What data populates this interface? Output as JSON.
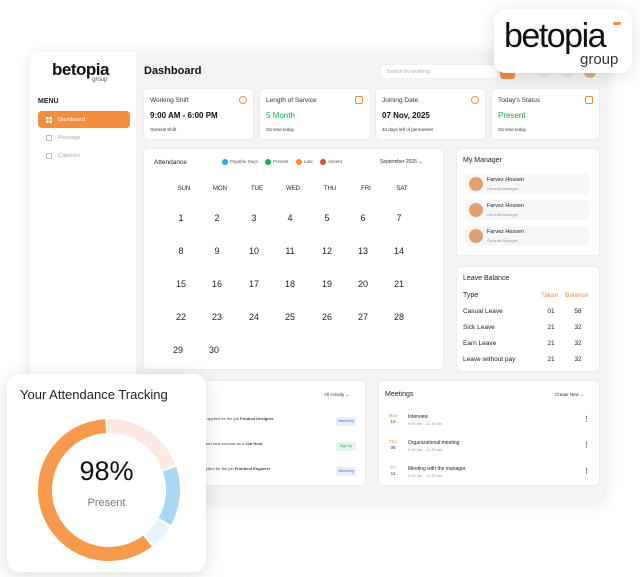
{
  "brand": {
    "name": "betopia",
    "sub": "group"
  },
  "sidebar": {
    "menu_label": "MENU",
    "items": [
      {
        "label": "Dashboard",
        "icon": "grid-icon",
        "active": true
      },
      {
        "label": "Message",
        "icon": "message-icon",
        "active": false
      },
      {
        "label": "Calender",
        "icon": "calendar-icon",
        "active": false
      }
    ]
  },
  "header": {
    "title": "Dashboard",
    "search_placeholder": "Search by anything"
  },
  "stats": [
    {
      "label": "Working Shift",
      "value": "9:00 AM - 6:00 PM",
      "sub": "General Shift",
      "icon": "clock-icon"
    },
    {
      "label": "Length of Service",
      "value": "5 Month",
      "sub": "On time today",
      "icon": "calendar-icon"
    },
    {
      "label": "Joining Date",
      "value": "07 Nov, 2025",
      "sub": "34 days left of permanent",
      "icon": "clock-icon"
    },
    {
      "label": "Today's Status",
      "value": "Present",
      "sub": "On time today",
      "icon": "calendar-icon"
    }
  ],
  "attendance": {
    "title": "Attendance",
    "legend": [
      {
        "label": "Payable Days",
        "color": "#2aa8e0",
        "mark": "1"
      },
      {
        "label": "Present",
        "color": "#1fa84f",
        "mark": "1"
      },
      {
        "label": "Late",
        "color": "#f28d40",
        "mark": "1"
      },
      {
        "label": "Absent",
        "color": "#e04b3a",
        "mark": "1"
      }
    ],
    "month": "September 2025",
    "weekdays": [
      "SUN",
      "MON",
      "TUE",
      "WED",
      "THU",
      "FRI",
      "SAT"
    ],
    "days": [
      "1",
      "2",
      "3",
      "4",
      "5",
      "6",
      "7",
      "8",
      "9",
      "10",
      "11",
      "12",
      "13",
      "14",
      "15",
      "16",
      "17",
      "18",
      "19",
      "20",
      "21",
      "22",
      "23",
      "24",
      "25",
      "26",
      "27",
      "28",
      "29",
      "30"
    ]
  },
  "manager": {
    "title": "My Manager",
    "people": [
      {
        "name": "Farvez Hossen",
        "role": "General Manager"
      },
      {
        "name": "Farvez Hossen",
        "role": "General Manager"
      },
      {
        "name": "Farvez Hossen",
        "role": "General Manager"
      }
    ]
  },
  "leave": {
    "title": "Leave Balance",
    "headers": {
      "type": "Type",
      "taken": "Taken",
      "balance": "Balance"
    },
    "rows": [
      {
        "type": "Casual Leave",
        "taken": "01",
        "balance": "58"
      },
      {
        "type": "Sick Leave",
        "taken": "21",
        "balance": "32"
      },
      {
        "type": "Earn Leave",
        "taken": "21",
        "balance": "32"
      },
      {
        "type": "Leave without pay",
        "taken": "21",
        "balance": "32"
      }
    ]
  },
  "activity": {
    "filter": "All Activity",
    "items": [
      {
        "pre": "y",
        "mid": " applied for the job ",
        "bold": "Product Designer",
        "badge": "Workshop",
        "badge_bg": "#e6eefc",
        "badge_color": "#4a72c8"
      },
      {
        "pre": "",
        "mid": "ated new account as a ",
        "bold": "Job Hunt",
        "badge": "Sign Up",
        "badge_bg": "#e3f6ea",
        "badge_color": "#1fa84f"
      },
      {
        "pre": "",
        "mid": "pplied for the job ",
        "bold": "Frontend Engineer",
        "badge": "Workshop",
        "badge_bg": "#e6eefc",
        "badge_color": "#4a72c8"
      }
    ]
  },
  "meetings": {
    "title": "Meetings",
    "create_label": "Create New",
    "items": [
      {
        "day": "Mon",
        "date": "10",
        "title": "Interview",
        "time": "9:00 am - 11:30 am"
      },
      {
        "day": "Thu",
        "date": "08",
        "title": "Organizational meeting",
        "time": "9:00 am - 11:30 am"
      },
      {
        "day": "Fri",
        "date": "11",
        "title": "Meeting with the manager",
        "time": "9:00 am - 11:30 am"
      }
    ]
  },
  "tracking": {
    "title": "Your Attendance Tracking",
    "percent": "98%",
    "status": "Present",
    "segments": [
      {
        "name": "present",
        "value": 60,
        "color": "#f79a4e"
      },
      {
        "name": "payable",
        "value": 14,
        "color": "#a9d6f2"
      },
      {
        "name": "light-blue",
        "value": 6,
        "color": "#e6f3fb"
      },
      {
        "name": "late",
        "value": 20,
        "color": "#fde9e4"
      }
    ]
  },
  "colors": {
    "accent": "#f28d40",
    "green": "#1fa84f"
  }
}
